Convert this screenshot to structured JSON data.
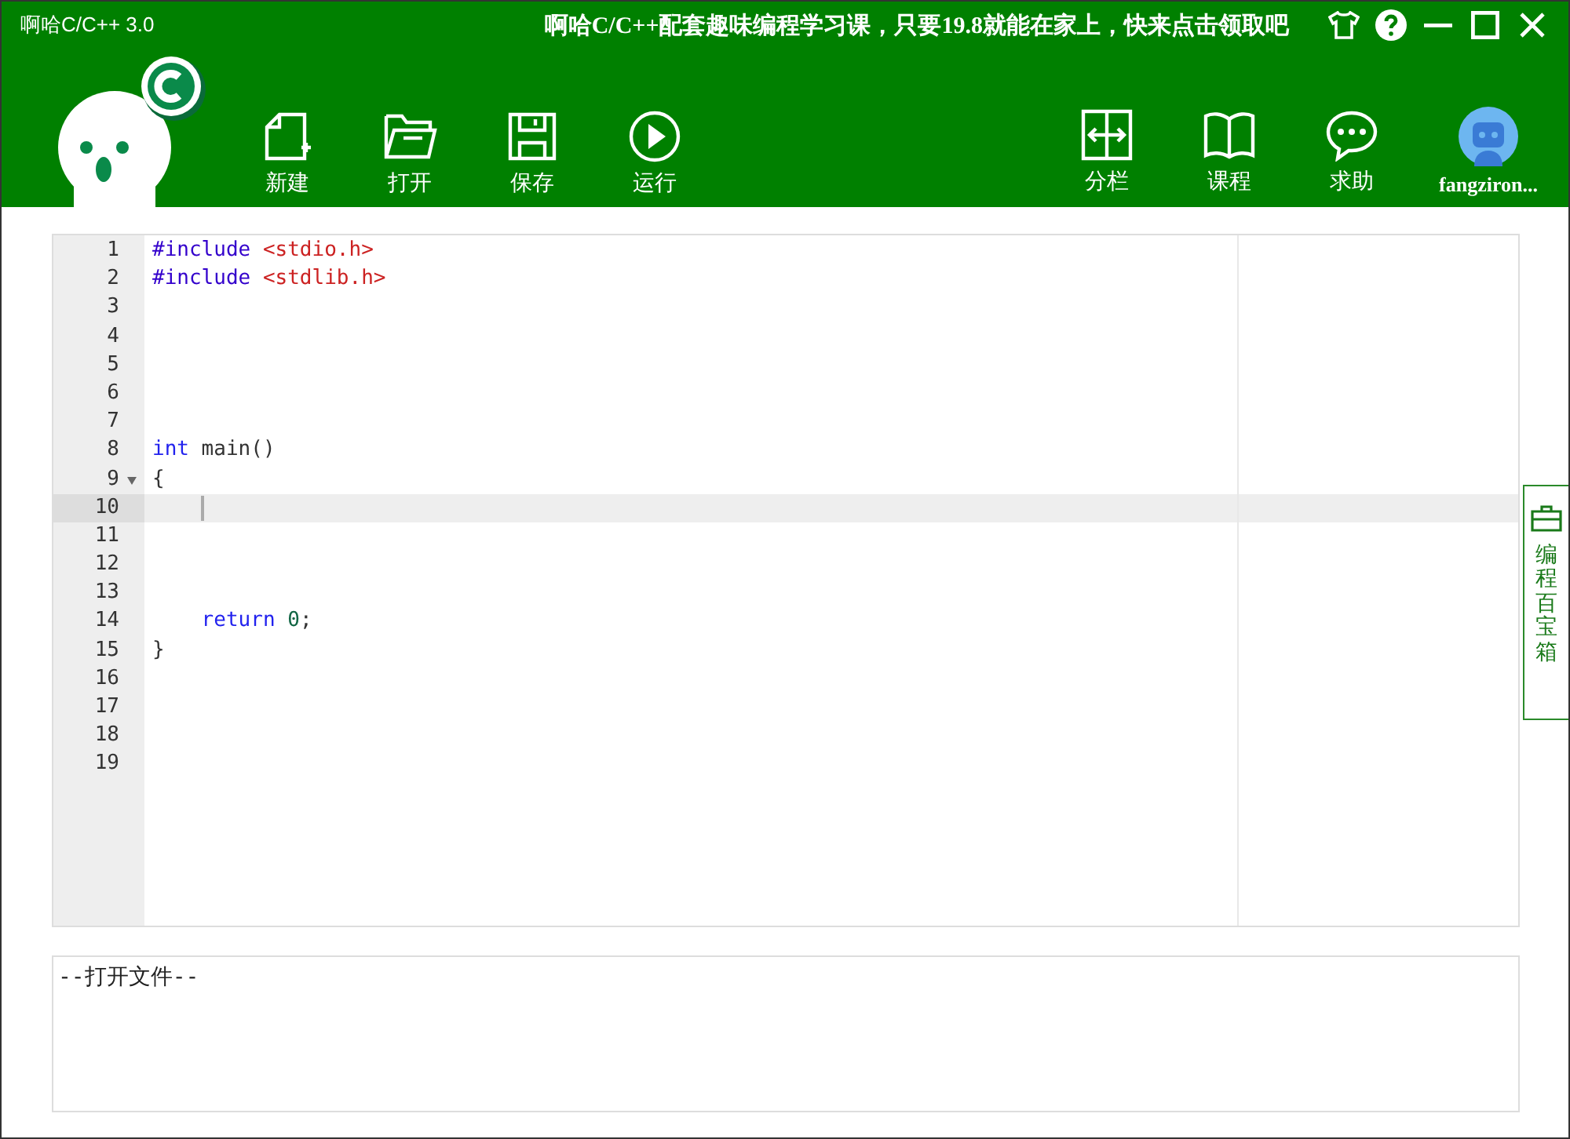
{
  "window": {
    "title": "啊哈C/C++ 3.0",
    "banner": "啊哈C/C++配套趣味编程学习课，只要19.8就能在家上，快来点击领取吧"
  },
  "toolbar_left": [
    {
      "kind": "new",
      "label": "新建"
    },
    {
      "kind": "open",
      "label": "打开"
    },
    {
      "kind": "save",
      "label": "保存"
    },
    {
      "kind": "run",
      "label": "运行"
    }
  ],
  "toolbar_right": [
    {
      "kind": "split",
      "label": "分栏"
    },
    {
      "kind": "course",
      "label": "课程"
    },
    {
      "kind": "help",
      "label": "求助"
    },
    {
      "kind": "user",
      "label": "fangziron..."
    }
  ],
  "editor": {
    "lines": [
      {
        "number": "1",
        "current": false,
        "foldable": false,
        "tokens": [
          {
            "kind": "directive",
            "text": "#include"
          },
          {
            "kind": "string",
            "text": " <stdio.h>"
          }
        ]
      },
      {
        "number": "2",
        "current": false,
        "foldable": false,
        "tokens": [
          {
            "kind": "directive",
            "text": "#include"
          },
          {
            "kind": "string",
            "text": " <stdlib.h>"
          }
        ]
      },
      {
        "number": "3",
        "current": false,
        "foldable": false
      },
      {
        "number": "4",
        "current": false,
        "foldable": false
      },
      {
        "number": "5",
        "current": false,
        "foldable": false
      },
      {
        "number": "6",
        "current": false,
        "foldable": false
      },
      {
        "number": "7",
        "current": false,
        "foldable": false
      },
      {
        "number": "8",
        "current": false,
        "foldable": false,
        "tokens": [
          {
            "kind": "keyword",
            "text": "int"
          },
          {
            "kind": "plain",
            "text": " main()"
          }
        ]
      },
      {
        "number": "9",
        "current": false,
        "foldable": true,
        "tokens": [
          {
            "kind": "plain",
            "text": "{"
          }
        ]
      },
      {
        "number": "10",
        "current": true,
        "foldable": false
      },
      {
        "number": "11",
        "current": false,
        "foldable": false
      },
      {
        "number": "12",
        "current": false,
        "foldable": false
      },
      {
        "number": "13",
        "current": false,
        "foldable": false
      },
      {
        "number": "14",
        "current": false,
        "foldable": false,
        "tokens": [
          {
            "kind": "keyword",
            "text": "    return"
          },
          {
            "kind": "number",
            "text": " 0"
          },
          {
            "kind": "plain",
            "text": ";"
          }
        ]
      },
      {
        "number": "15",
        "current": false,
        "foldable": false,
        "tokens": [
          {
            "kind": "plain",
            "text": "}"
          }
        ]
      },
      {
        "number": "16",
        "current": false,
        "foldable": false
      },
      {
        "number": "17",
        "current": false,
        "foldable": false
      },
      {
        "number": "18",
        "current": false,
        "foldable": false
      },
      {
        "number": "19",
        "current": false,
        "foldable": false
      }
    ]
  },
  "output": {
    "text": "--打开文件--"
  },
  "side_tab": {
    "label": "编程百宝箱"
  }
}
